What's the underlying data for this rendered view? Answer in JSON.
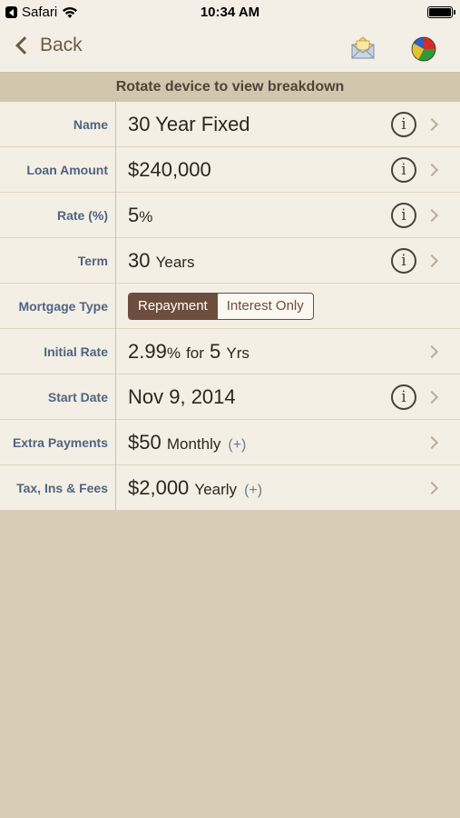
{
  "status_bar": {
    "back_app": "Safari",
    "time": "10:34 AM"
  },
  "nav": {
    "back_label": "Back",
    "mail_icon": "mail-envelope-icon",
    "chart_icon": "pie-chart-icon"
  },
  "banner": "Rotate device to view breakdown",
  "rows": {
    "name": {
      "label": "Name",
      "value": "30 Year Fixed"
    },
    "loan_amount": {
      "label": "Loan Amount",
      "value": "$240,000"
    },
    "rate": {
      "label": "Rate (%)",
      "value": "5",
      "unit": "%"
    },
    "term": {
      "label": "Term",
      "value": "30",
      "unit": "Years"
    },
    "mortgage_type": {
      "label": "Mortgage Type",
      "options": [
        "Repayment",
        "Interest Only"
      ],
      "selected": "Repayment"
    },
    "initial_rate": {
      "label": "Initial Rate",
      "rate": "2.99",
      "pct": "%",
      "for": "for",
      "years": "5",
      "years_unit": "Yrs"
    },
    "start_date": {
      "label": "Start Date",
      "value": "Nov 9, 2014"
    },
    "extra_payments": {
      "label": "Extra Payments",
      "value": "$50",
      "unit": "Monthly",
      "plus": "(+)"
    },
    "tax_ins_fees": {
      "label": "Tax, Ins & Fees",
      "value": "$2,000",
      "unit": "Yearly",
      "plus": "(+)"
    }
  },
  "info_symbol": "i",
  "colors": {
    "accent": "#6d4d3d",
    "label_blue": "#4f6482",
    "background": "#d9ccb6",
    "table_bg": "#f4efe4"
  }
}
